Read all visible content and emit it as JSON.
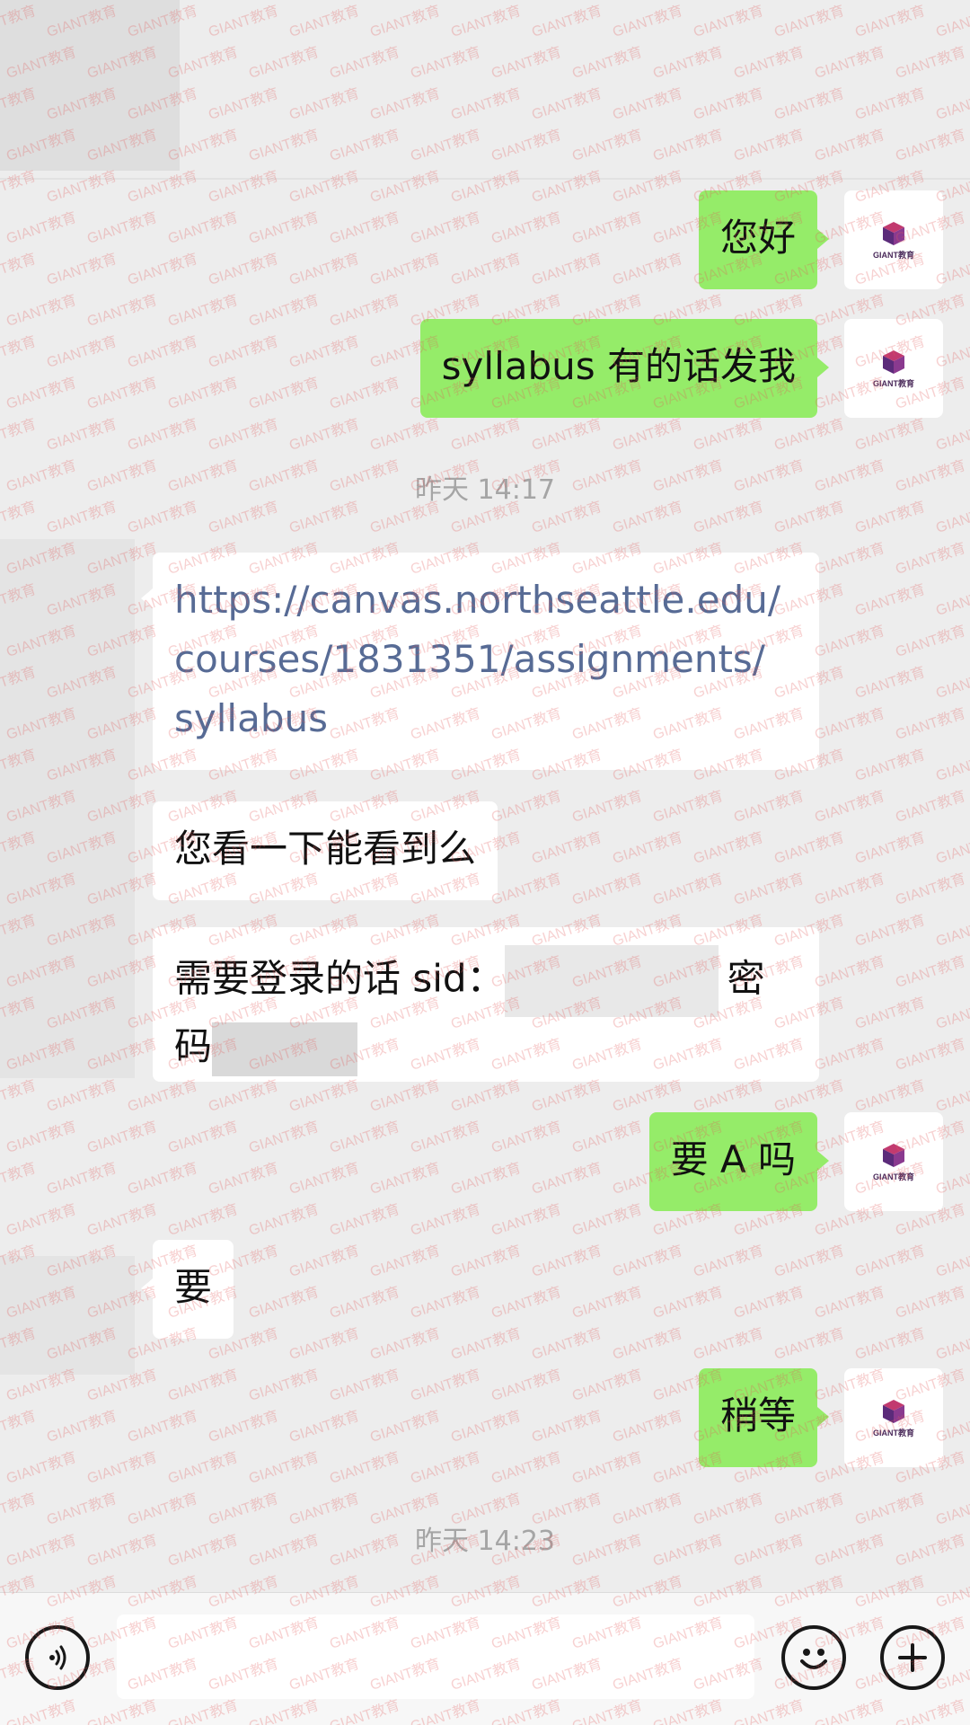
{
  "timestamps": {
    "t1": "昨天 14:17",
    "t2": "昨天 14:23"
  },
  "messages": {
    "m1": "您好",
    "m2": "syllabus 有的话发我",
    "m3_link": "https://canvas.northseattle.edu/courses/1831351/assignments/syllabus",
    "m3_line1": "https://canvas.northseattle.edu/",
    "m3_line2": "courses/1831351/assignments/",
    "m3_line3": "syllabus",
    "m4": "您看一下能看到么",
    "m5_prefix": "需要登录的话 sid：",
    "m5_middle": "密",
    "m5_line2": "码",
    "m6": "要 A 吗",
    "m7": "要",
    "m8": "稍等"
  },
  "avatar": {
    "brand_text": "GIANT教育"
  },
  "watermark": {
    "text": "GIANT教育"
  },
  "icons": {
    "voice": "voice-icon",
    "emoji": "emoji-icon",
    "plus": "plus-icon"
  },
  "colors": {
    "background": "#ededed",
    "sent_bubble": "#95ec69",
    "received_bubble": "#ffffff",
    "link": "#576b95",
    "timestamp": "#a5a5a5",
    "watermark": "#e15a5a"
  }
}
